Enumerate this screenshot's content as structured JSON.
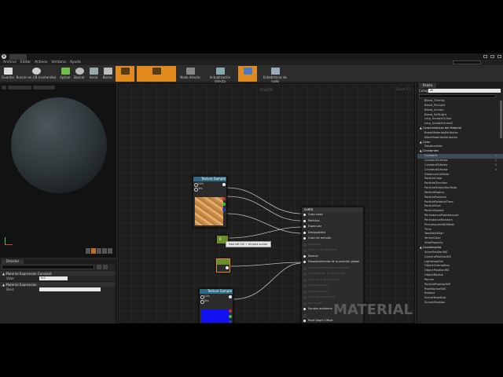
{
  "menu": {
    "items": [
      "Archivo",
      "Editar",
      "Activos",
      "Ventana",
      "Ayuda"
    ]
  },
  "toolbar": [
    {
      "label": "Guardar",
      "active": false
    },
    {
      "label": "Buscar en CB (contenido)",
      "active": false
    },
    {
      "label": "Aplicar",
      "active": false
    },
    {
      "label": "Buscar",
      "active": false
    },
    {
      "label": "Inicio",
      "active": false
    },
    {
      "label": "Borrar",
      "active": false
    },
    {
      "label": "",
      "active": true
    },
    {
      "label": "",
      "active": true
    },
    {
      "label": "Nodo directo",
      "active": false
    },
    {
      "label": "Actualización directa",
      "active": false
    },
    {
      "label": "",
      "active": true
    },
    {
      "label": "Estadísticas de nodo",
      "active": false
    }
  ],
  "details": {
    "tab": "Detalles",
    "sections": [
      {
        "title": "▲ Material Expression Constant",
        "props": [
          {
            "label": "Valor",
            "value": "0.0"
          }
        ]
      },
      {
        "title": "▲ Material Expression",
        "props": [
          {
            "label": "Desc",
            "value": ""
          }
        ]
      }
    ]
  },
  "graph": {
    "title": "cuero",
    "zoom": "Zoom 1:1",
    "watermark": "MATERIAL",
    "tooltip": "Hold left Ctrl + Alt para ocultar",
    "texture1": {
      "title": "Texture Sample",
      "pins": [
        "UVs",
        "Tex"
      ]
    },
    "texture2": {
      "title": "Texture Sample",
      "pins": [
        "UVs",
        "Tex"
      ]
    },
    "const1": {
      "title": "0"
    },
    "const2": {
      "title": ""
    },
    "material_node": {
      "title": "cuero",
      "rows": [
        {
          "label": "Color base",
          "active": true
        },
        {
          "label": "Metálico",
          "active": true
        },
        {
          "label": "Especular",
          "active": true
        },
        {
          "label": "Desigualdad",
          "active": true
        },
        {
          "label": "Color de emisión",
          "active": true
        },
        {
          "label": "Opacidad",
          "active": false
        },
        {
          "label": "Máscara de opacidad",
          "active": false
        },
        {
          "label": "Normal",
          "active": true
        },
        {
          "label": "Desplazamiento de la posición global",
          "active": true
        },
        {
          "label": "Desplazamiento de la mundial",
          "active": false
        },
        {
          "label": "Multiplicador de teselación",
          "active": false
        },
        {
          "label": "Color de subsuperficie",
          "active": false
        },
        {
          "label": "Personalizado0",
          "active": false
        },
        {
          "label": "Personalizado1",
          "active": false
        },
        {
          "label": "Oclusión ambiental",
          "active": false
        },
        {
          "label": "Refracción",
          "active": false
        },
        {
          "label": "Sondeo ambiente",
          "active": true
        },
        {
          "label": "",
          "active": false
        },
        {
          "label": "Pixel Depth Offset",
          "active": true
        }
      ]
    }
  },
  "palette": {
    "tab": "Paleta",
    "category_label": "Categoría",
    "category_value": "All",
    "items": [
      {
        "label": "Blend_Overlay",
        "section": false
      },
      {
        "label": "Blend_PinLight",
        "section": false
      },
      {
        "label": "Blend_Screen",
        "section": false
      },
      {
        "label": "Blend_SoftLight",
        "section": false
      },
      {
        "label": "Lerp_ScratchGrime",
        "section": false
      },
      {
        "label": "Lerp_ScratchGrime2",
        "section": false
      },
      {
        "label": "▲ Características del Material",
        "section": true
      },
      {
        "label": "BreakMaterialAttributes",
        "section": false
      },
      {
        "label": "MakeMaterialAttributes",
        "section": false
      },
      {
        "label": "▲ Color",
        "section": true
      },
      {
        "label": "Desaturation",
        "section": false
      },
      {
        "label": "▲ Constantes",
        "section": true
      },
      {
        "label": "Constant",
        "section": false,
        "selected": true,
        "num": "1"
      },
      {
        "label": "Constant2Vector",
        "section": false,
        "num": "2"
      },
      {
        "label": "Constant3Vector",
        "section": false,
        "num": "3"
      },
      {
        "label": "Constant4Vector",
        "section": false,
        "num": "4"
      },
      {
        "label": "DistanceCullFade",
        "section": false
      },
      {
        "label": "ParticleColor",
        "section": false
      },
      {
        "label": "ParticleDirection",
        "section": false
      },
      {
        "label": "ParticleMotionBlurFade",
        "section": false
      },
      {
        "label": "ParticleRadius",
        "section": false
      },
      {
        "label": "ParticleRandom",
        "section": false
      },
      {
        "label": "ParticleRelativeTime",
        "section": false
      },
      {
        "label": "ParticleSize",
        "section": false
      },
      {
        "label": "ParticleSpeed",
        "section": false
      },
      {
        "label": "PerInstanceFadeAmount",
        "section": false
      },
      {
        "label": "PerInstanceRandom",
        "section": false
      },
      {
        "label": "PrecomputedAOMask",
        "section": false
      },
      {
        "label": "Time",
        "section": false
      },
      {
        "label": "TwoSidedSign",
        "section": false
      },
      {
        "label": "VertexColor",
        "section": false
      },
      {
        "label": "ViewProperty",
        "section": false
      },
      {
        "label": "▲ Coordenadas",
        "section": true
      },
      {
        "label": "ActorPositionWS",
        "section": false
      },
      {
        "label": "CameraPositionWS",
        "section": false
      },
      {
        "label": "LightmapUVs",
        "section": false
      },
      {
        "label": "ObjectOrientation",
        "section": false
      },
      {
        "label": "ObjectPositionWS",
        "section": false
      },
      {
        "label": "ObjectRadius",
        "section": false
      },
      {
        "label": "Panner",
        "section": false
      },
      {
        "label": "ParticlePositionWS",
        "section": false
      },
      {
        "label": "PixelNormalWS",
        "section": false
      },
      {
        "label": "Rotator",
        "section": false
      },
      {
        "label": "SceneTexelSize",
        "section": false
      },
      {
        "label": "ScreenPosition",
        "section": false
      }
    ]
  },
  "colors": {
    "accent": "#e08a1e",
    "node_header": "#2f6b84",
    "blue_texture": "#1010f0"
  }
}
